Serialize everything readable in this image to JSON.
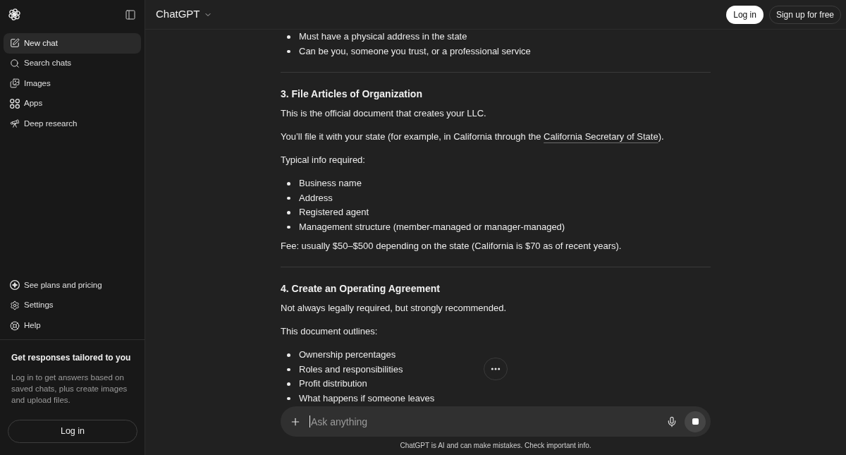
{
  "sidebar": {
    "top_items": [
      {
        "label": "New chat",
        "selected": true
      },
      {
        "label": "Search chats",
        "selected": false
      },
      {
        "label": "Images",
        "selected": false
      },
      {
        "label": "Apps",
        "selected": false
      },
      {
        "label": "Deep research",
        "selected": false
      }
    ],
    "bottom_items": [
      {
        "label": "See plans and pricing"
      },
      {
        "label": "Settings"
      },
      {
        "label": "Help"
      }
    ],
    "promo": {
      "title": "Get responses tailored to you",
      "text": "Log in to get answers based on saved chats, plus create images and upload files.",
      "button": "Log in"
    }
  },
  "header": {
    "model_menu": "ChatGPT",
    "buttons": [
      {
        "label": "Log in",
        "kind": "primary"
      },
      {
        "label": "Sign up for free",
        "kind": "outline"
      }
    ]
  },
  "conversation": {
    "blocks": [
      {
        "kind": "list",
        "items": [
          "Must have a physical address in the state",
          "Can be you, someone you trust, or a professional service"
        ]
      },
      {
        "kind": "rule"
      },
      {
        "kind": "heading",
        "text": "3. File Articles of Organization"
      },
      {
        "kind": "paragraph",
        "text": "This is the official document that creates your LLC."
      },
      {
        "kind": "paragraph",
        "text": "You’ll file it with your state (for example, in California through the ",
        "link": "California Secretary of State",
        "text_after": ")."
      },
      {
        "kind": "paragraph",
        "text": "Typical info required:"
      },
      {
        "kind": "list",
        "items": [
          "Business name",
          "Address",
          "Registered agent",
          "Management structure (member-managed or manager-managed)"
        ]
      },
      {
        "kind": "paragraph",
        "text": "Fee: usually $50–$500 depending on the state (California is $70 as of recent years)."
      },
      {
        "kind": "rule"
      },
      {
        "kind": "heading",
        "text": "4. Create an Operating Agreement"
      },
      {
        "kind": "paragraph",
        "text": "Not always legally required, but strongly recommended."
      },
      {
        "kind": "paragraph",
        "text": "This document outlines:"
      },
      {
        "kind": "list",
        "items": [
          "Ownership percentages",
          "Roles and responsibilities",
          "Profit distribution",
          "What happens if someone leaves"
        ]
      }
    ]
  },
  "composer": {
    "placeholder": "Ask anything"
  },
  "disclaimer": "ChatGPT is AI and can make mistakes. Check important info."
}
